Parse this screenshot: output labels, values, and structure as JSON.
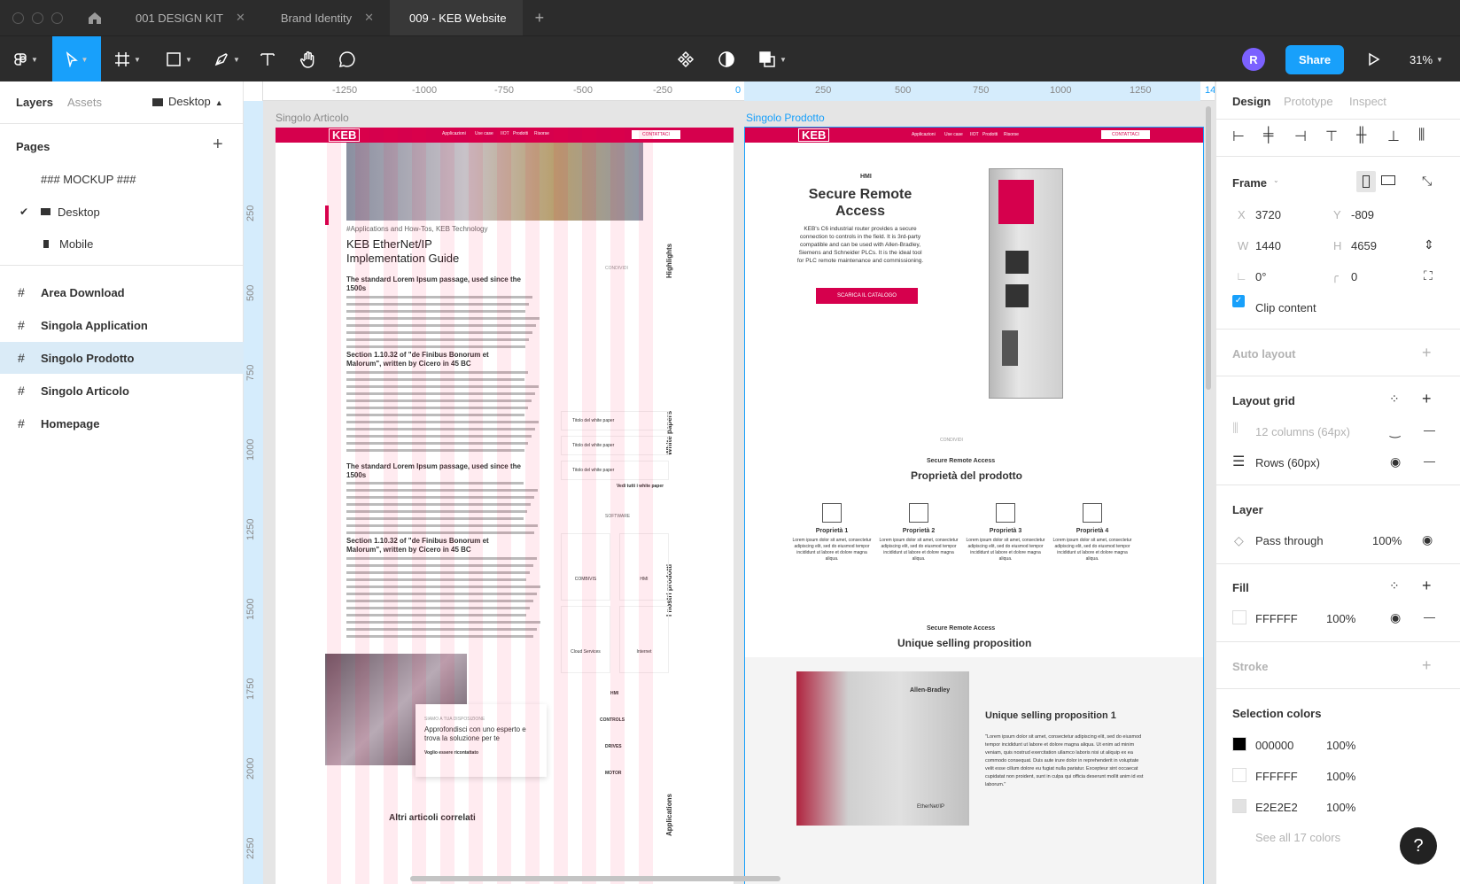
{
  "tabs": [
    {
      "label": "001 DESIGN KIT",
      "active": false
    },
    {
      "label": "Brand Identity",
      "active": false
    },
    {
      "label": "009 - KEB Website",
      "active": true
    }
  ],
  "toolbar": {
    "avatar_initial": "R",
    "share_label": "Share",
    "zoom": "31%"
  },
  "left_panel": {
    "tab_layers": "Layers",
    "tab_assets": "Assets",
    "device": "Desktop",
    "pages_title": "Pages",
    "pages": [
      {
        "label": "### MOCKUP ###",
        "checked": false
      },
      {
        "label": "Desktop",
        "checked": true
      },
      {
        "label": "Mobile",
        "checked": false
      }
    ],
    "layers": [
      {
        "label": "Area Download",
        "selected": false
      },
      {
        "label": "Singola Application",
        "selected": false
      },
      {
        "label": "Singolo Prodotto",
        "selected": true
      },
      {
        "label": "Singolo Articolo",
        "selected": false
      },
      {
        "label": "Homepage",
        "selected": false
      }
    ]
  },
  "canvas": {
    "ruler_h": [
      "-1250",
      "-1000",
      "-750",
      "-500",
      "-250",
      "0",
      "250",
      "500",
      "750",
      "1000",
      "1250",
      "14"
    ],
    "ruler_v": [
      "250",
      "500",
      "750",
      "1000",
      "1250",
      "1500",
      "1750",
      "2000",
      "2250"
    ],
    "frame_left_label": "Singolo Articolo",
    "frame_right_label": "Singolo Prodotto",
    "left_page": {
      "logo": "KEB",
      "nav": [
        "Applicazioni",
        "Use case",
        "IIOT",
        "Prodotti",
        "Risorse"
      ],
      "contact": "CONTATTACI",
      "breadcrumb": "#Applications and How-Tos, KEB Technology",
      "title": "KEB EtherNet/IP Implementation Guide",
      "section1": "The standard Lorem Ipsum passage, used since the 1500s",
      "section2": "Section 1.10.32 of \"de Finibus Bonorum et Malorum\", written by Cicero in 45 BC",
      "section3": "The standard Lorem Ipsum passage, used since the 1500s",
      "section4": "Section 1.10.32 of \"de Finibus Bonorum et Malorum\", written by Cicero in 45 BC",
      "share": "CONDIVIDI",
      "highlights": "Highlights",
      "white_papers": "White papers",
      "wp_items": [
        "Titolo del white paper",
        "Titolo del white paper",
        "Titolo del white paper"
      ],
      "all_wp": "Vedi tutti i white paper",
      "software": "SOFTWARE",
      "products_label": "I nostri prodotti",
      "sw_items": [
        "COMBIVIS",
        "HMI",
        "Cloud Services",
        "Internet"
      ],
      "menu": [
        "HMI",
        "CONTROLS",
        "DRIVES",
        "MOTOR"
      ],
      "expert_kicker": "SIAMO A TUA DISPOSIZIONE",
      "expert_title": "Approfondisci con uno esperto e trova la soluzione per te",
      "expert_cta": "Voglio essere ricontattato",
      "related": "Altri articoli correlati",
      "applications": "Applications"
    },
    "right_page": {
      "logo": "KEB",
      "nav": [
        "Applicazioni",
        "Use case",
        "IIOT",
        "Prodotti",
        "Risorse"
      ],
      "contact": "CONTATTACI",
      "hmi": "HMI",
      "title": "Secure Remote Access",
      "desc": "KEB's C6 industrial router provides a secure connection to controls in the field. It is 3rd-party compatible and can be used with Allen-Bradley, Siemens and Schneider PLCs. It is the ideal tool for PLC remote maintenance and commissioning.",
      "cta": "SCARICA IL CATALOGO",
      "share": "CONDIVIDI",
      "props_kicker": "Secure Remote Access",
      "props_title": "Proprietà del prodotto",
      "props": [
        {
          "name": "Proprietà 1",
          "text": "Lorem ipsum dolor sit amet, consectetur adipiscing elit, sed do eiusmod tempor incididunt ut labore et dolore magna aliqua."
        },
        {
          "name": "Proprietà 2",
          "text": "Lorem ipsum dolor sit amet, consectetur adipiscing elit, sed do eiusmod tempor incididunt ut labore et dolore magna aliqua."
        },
        {
          "name": "Proprietà 3",
          "text": "Lorem ipsum dolor sit amet, consectetur adipiscing elit, sed do eiusmod tempor incididunt ut labore et dolore magna aliqua."
        },
        {
          "name": "Proprietà 4",
          "text": "Lorem ipsum dolor sit amet, consectetur adipiscing elit, sed do eiusmod tempor incididunt ut labore et dolore magna aliqua."
        }
      ],
      "usp_kicker": "Secure Remote Access",
      "usp_title": "Unique selling proposition",
      "usp1_title": "Unique selling proposition 1",
      "usp1_text": "\"Lorem ipsum dolor sit amet, consectetur adipiscing elit, sed do eiusmod tempor incididunt ut labore et dolore magna aliqua. Ut enim ad minim veniam, quis nostrud exercitation ullamco laboris nisi ut aliquip ex ea commodo consequat. Duis aute irure dolor in reprehenderit in voluptate velit esse cillum dolore eu fugiat nulla pariatur. Excepteur sint occaecat cupidatat non proident, sunt in culpa qui officia deserunt mollit anim id est laborum.\"",
      "device_brand": "Allen-Bradley",
      "device_label": "EtherNet/IP"
    }
  },
  "right_panel": {
    "tabs": [
      "Design",
      "Prototype",
      "Inspect"
    ],
    "frame_title": "Frame",
    "x_label": "X",
    "x": "3720",
    "y_label": "Y",
    "y": "-809",
    "w_label": "W",
    "w": "1440",
    "h_label": "H",
    "h": "4659",
    "rotation": "0°",
    "radius": "0",
    "clip_content": "Clip content",
    "auto_layout": "Auto layout",
    "layout_grid": "Layout grid",
    "grids": [
      "12 columns (64px)",
      "Rows (60px)"
    ],
    "layer_title": "Layer",
    "blend": "Pass through",
    "opacity": "100%",
    "fill_title": "Fill",
    "fill_hex": "FFFFFF",
    "fill_opacity": "100%",
    "stroke_title": "Stroke",
    "selection_colors_title": "Selection colors",
    "selection_colors": [
      {
        "hex": "000000",
        "opacity": "100%",
        "color": "#000000"
      },
      {
        "hex": "FFFFFF",
        "opacity": "100%",
        "color": "#FFFFFF"
      },
      {
        "hex": "E2E2E2",
        "opacity": "100%",
        "color": "#E2E2E2"
      }
    ],
    "see_all": "See all 17 colors"
  },
  "colors": {
    "accent": "#18a0fb",
    "brand": "#d6004d",
    "chrome": "#2c2c2c"
  }
}
